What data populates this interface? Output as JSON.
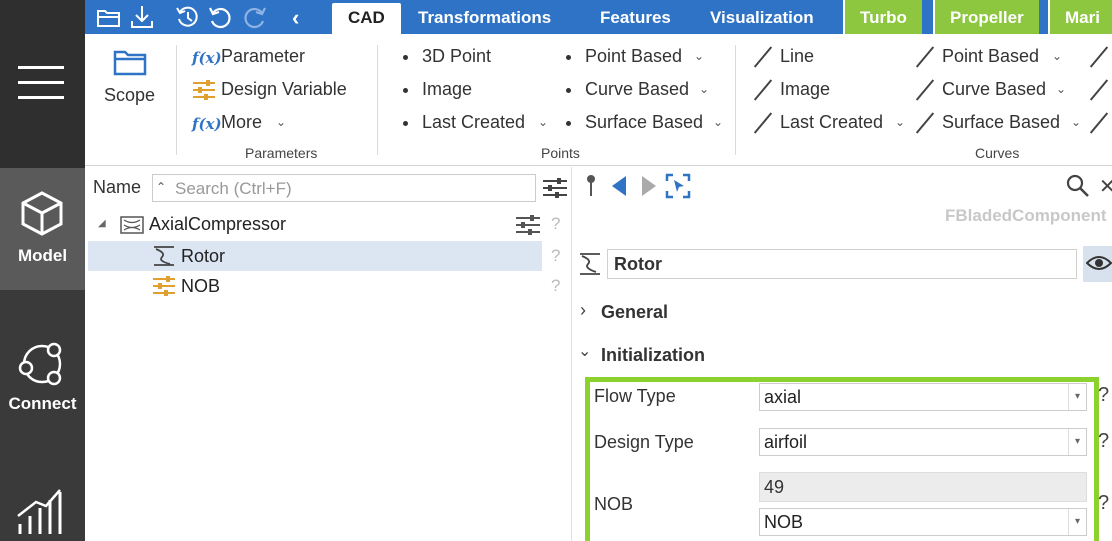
{
  "rail": {
    "items": [
      {
        "label": "Model",
        "icon": "cube-icon"
      },
      {
        "label": "Connect",
        "icon": "connect-nodes-icon"
      },
      {
        "label": "",
        "icon": "chart-bars-icon"
      }
    ]
  },
  "tabs": {
    "items": [
      "CAD",
      "Transformations",
      "Features",
      "Visualization",
      "Turbo",
      "Propeller",
      "Mari"
    ],
    "selected": "CAD"
  },
  "ribbon": {
    "scope_label": "Scope",
    "parameters": {
      "group_label": "Parameters",
      "fx": "f(x)",
      "items": [
        "Parameter",
        "Design Variable",
        "More"
      ]
    },
    "points": {
      "group_label": "Points",
      "col1": [
        "3D Point",
        "Image",
        "Last Created"
      ],
      "col2": [
        "Point Based",
        "Curve Based",
        "Surface Based"
      ]
    },
    "curves": {
      "group_label": "Curves",
      "col1": [
        "Line",
        "Image",
        "Last Created"
      ],
      "col2": [
        "Point Based",
        "Curve Based",
        "Surface Based"
      ]
    }
  },
  "tree": {
    "header": "Name",
    "search_placeholder": "Search (Ctrl+F)",
    "rows": [
      {
        "label": "AxialCompressor",
        "q": "?"
      },
      {
        "label": "Rotor",
        "q": "?"
      },
      {
        "label": "NOB",
        "q": "?"
      }
    ]
  },
  "props": {
    "component_type": "FBladedComponent",
    "name_value": "Rotor",
    "sections": [
      "General",
      "Initialization"
    ],
    "fields": {
      "flow_type": {
        "label": "Flow Type",
        "value": "axial"
      },
      "design_type": {
        "label": "Design Type",
        "value": "airfoil"
      },
      "nob": {
        "label": "NOB",
        "value": "49",
        "source": "NOB"
      }
    },
    "help": "?"
  },
  "colors": {
    "accent": "#2f73c6",
    "green_tab": "#8dc63f",
    "highlight": "#8dd12e",
    "rail": "#3a3a3a"
  }
}
